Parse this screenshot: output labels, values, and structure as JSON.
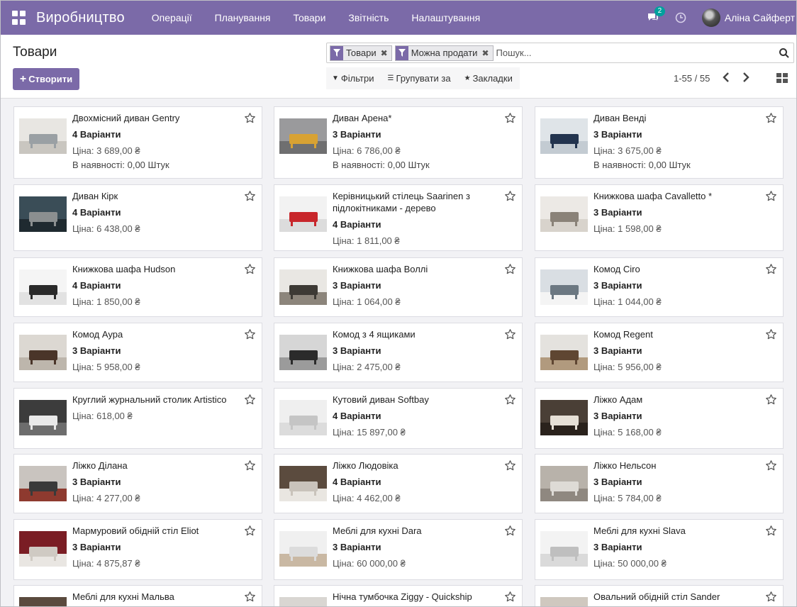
{
  "navbar": {
    "brand": "Виробництво",
    "menu": [
      "Операції",
      "Планування",
      "Товари",
      "Звітність",
      "Налаштування"
    ],
    "chat_count": "2",
    "user_name": "Аліна Сайферт",
    "color": "#7b6aa8"
  },
  "control": {
    "title": "Товари",
    "create_label": "Створити",
    "facets": [
      "Товари",
      "Можна продати"
    ],
    "search_placeholder": "Пошук...",
    "filters_label": "Фільтри",
    "group_by_label": "Групувати за",
    "favorites_label": "Закладки",
    "pager": "1-55 / 55"
  },
  "products": [
    {
      "name": "Двохмісний диван Gentry",
      "variants": "4 Варіанти",
      "price": "Ціна: 3 689,00 ₴",
      "stock": "В наявності: 0,00 Штук",
      "thumb": "sofa-grey"
    },
    {
      "name": "Диван Арена*",
      "variants": "3 Варіанти",
      "price": "Ціна: 6 786,00 ₴",
      "stock": "В наявності: 0,00 Штук",
      "thumb": "sofa-yellow"
    },
    {
      "name": "Диван Венді",
      "variants": "3 Варіанти",
      "price": "Ціна: 3 675,00 ₴",
      "stock": "В наявності: 0,00 Штук",
      "thumb": "sofa-blue"
    },
    {
      "name": "Диван Кірк",
      "variants": "4 Варіанти",
      "price": "Ціна: 6 438,00 ₴",
      "thumb": "sofa-dark"
    },
    {
      "name": "Керівницький стілець Saarinen з підлокітниками - дерево",
      "variants": "4 Варіанти",
      "price": "Ціна: 1 811,00 ₴",
      "thumb": "chairs-red"
    },
    {
      "name": "Книжкова шафа Cavalletto *",
      "variants": "3 Варіанти",
      "price": "Ціна: 1 598,00 ₴",
      "thumb": "shelf-wall"
    },
    {
      "name": "Книжкова шафа Hudson",
      "variants": "4 Варіанти",
      "price": "Ціна: 1 850,00 ₴",
      "thumb": "shelf-black"
    },
    {
      "name": "Книжкова шафа Воллі",
      "variants": "3 Варіанти",
      "price": "Ціна: 1 064,00 ₴",
      "thumb": "shelf-grid"
    },
    {
      "name": "Комод Ciro",
      "variants": "3 Варіанти",
      "price": "Ціна: 1 044,00 ₴",
      "thumb": "dresser-white"
    },
    {
      "name": "Комод Аура",
      "variants": "3 Варіанти",
      "price": "Ціна: 5 958,00 ₴",
      "thumb": "dresser-brown"
    },
    {
      "name": "Комод з 4 ящиками",
      "variants": "3 Варіанти",
      "price": "Ціна: 2 475,00 ₴",
      "thumb": "dresser-black"
    },
    {
      "name": "Комод  Regent",
      "variants": "3 Варіанти",
      "price": "Ціна: 5 956,00 ₴",
      "thumb": "dresser-wood"
    },
    {
      "name": "Круглий журнальний столик Artistico",
      "price": "Ціна: 618,00 ₴",
      "thumb": "table-x"
    },
    {
      "name": "Кутовий диван Softbay",
      "variants": "4 Варіанти",
      "price": "Ціна: 15 897,00 ₴",
      "thumb": "sofa-white"
    },
    {
      "name": "Ліжко Адам",
      "variants": "3 Варіанти",
      "price": "Ціна: 5 168,00 ₴",
      "thumb": "bed-dark"
    },
    {
      "name": "Ліжко Ділана",
      "variants": "3 Варіанти",
      "price": "Ціна: 4 277,00 ₴",
      "thumb": "bed-red"
    },
    {
      "name": "Ліжко Людовіка",
      "variants": "4 Варіанти",
      "price": "Ціна: 4 462,00 ₴",
      "thumb": "bed-white"
    },
    {
      "name": "Ліжко Нельсон",
      "variants": "3 Варіанти",
      "price": "Ціна: 5 784,00 ₴",
      "thumb": "bed-grey"
    },
    {
      "name": "Мармуровий обідній стіл Eliot",
      "variants": "3 Варіанти",
      "price": "Ціна: 4 875,87 ₴",
      "thumb": "table-marble"
    },
    {
      "name": "Меблі для кухні Dara",
      "variants": "3 Варіанти",
      "price": "Ціна: 60 000,00 ₴",
      "thumb": "kitchen-white"
    },
    {
      "name": "Меблі для кухні Slava",
      "variants": "3 Варіанти",
      "price": "Ціна: 50 000,00 ₴",
      "thumb": "kitchen-light"
    },
    {
      "name": "Меблі для кухні Мальва",
      "thumb": "kitchen-dark"
    },
    {
      "name": "Нічна тумбочка Ziggy - Quickship",
      "thumb": "nightstand"
    },
    {
      "name": "Овальний обідній стіл Sander",
      "thumb": "table-oval"
    }
  ]
}
